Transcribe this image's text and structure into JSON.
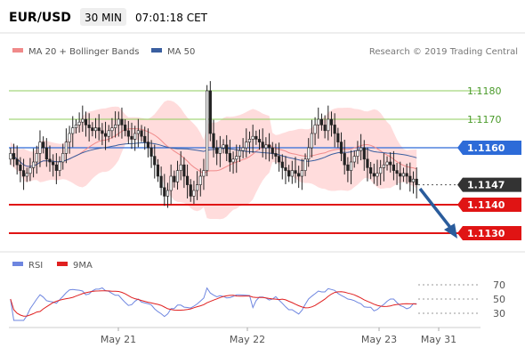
{
  "header": {
    "pair": "EUR/USD",
    "timeframe": "30 MIN",
    "time": "07:01:18 CET"
  },
  "legend": {
    "ma20": "MA 20 + Bollinger Bands",
    "ma50": "MA 50",
    "credit": "Research © 2019 Trading Central"
  },
  "colors": {
    "resistance": "#8fce5c",
    "current_level": "#2d6bd8",
    "support": "#e01414",
    "last_price_box": "#333333",
    "ma20_band": "#ffd6d6",
    "ma20": "#f08a8a",
    "ma50": "#3a5fa0",
    "candle": "#222222",
    "rsi": "#6e86e0",
    "rsi_ma": "#e02020",
    "arrow": "#2a5c9c"
  },
  "chart_data": [
    {
      "type": "candlestick",
      "title": "",
      "x_labels": [
        "May 21",
        "May 22",
        "May 23",
        "May 31"
      ],
      "ylim": [
        1.1125,
        1.119
      ],
      "levels": [
        {
          "value": 1.118,
          "label": "1.1180",
          "kind": "resistance"
        },
        {
          "value": 1.117,
          "label": "1.1170",
          "kind": "resistance"
        },
        {
          "value": 1.116,
          "label": "1.1160",
          "kind": "current"
        },
        {
          "value": 1.1147,
          "label": "1.1147",
          "kind": "last"
        },
        {
          "value": 1.114,
          "label": "1.1140",
          "kind": "support"
        },
        {
          "value": 1.113,
          "label": "1.1130",
          "kind": "support"
        }
      ],
      "last_price": 1.1147,
      "candles_close": [
        1.1158,
        1.1156,
        1.1154,
        1.1152,
        1.115,
        1.1151,
        1.1153,
        1.1155,
        1.1158,
        1.1162,
        1.116,
        1.1156,
        1.1155,
        1.1154,
        1.1152,
        1.1155,
        1.1158,
        1.1162,
        1.1165,
        1.1167,
        1.1168,
        1.1169,
        1.117,
        1.1168,
        1.1167,
        1.1166,
        1.1167,
        1.1166,
        1.1165,
        1.1164,
        1.1166,
        1.1167,
        1.1168,
        1.117,
        1.1168,
        1.1166,
        1.1164,
        1.1163,
        1.1165,
        1.1166,
        1.1164,
        1.1162,
        1.116,
        1.1157,
        1.1154,
        1.115,
        1.1146,
        1.1143,
        1.1145,
        1.115,
        1.1148,
        1.1152,
        1.1154,
        1.115,
        1.1147,
        1.1143,
        1.1145,
        1.1147,
        1.115,
        1.1152,
        1.118,
        1.1165,
        1.116,
        1.1158,
        1.116,
        1.1161,
        1.1158,
        1.1155,
        1.1156,
        1.1157,
        1.1159,
        1.116,
        1.1162,
        1.1163,
        1.1164,
        1.1163,
        1.1162,
        1.116,
        1.1161,
        1.116,
        1.1158,
        1.1157,
        1.1155,
        1.1153,
        1.1152,
        1.115,
        1.1152,
        1.1151,
        1.115,
        1.1152,
        1.1156,
        1.116,
        1.1165,
        1.1168,
        1.117,
        1.1168,
        1.1166,
        1.117,
        1.1168,
        1.1165,
        1.1162,
        1.1158,
        1.1154,
        1.1152,
        1.1155,
        1.1157,
        1.1159,
        1.116,
        1.1156,
        1.1153,
        1.1151,
        1.115,
        1.1151,
        1.1153,
        1.1154,
        1.1155,
        1.1154,
        1.1152,
        1.1151,
        1.115,
        1.1151,
        1.115,
        1.1148,
        1.1149,
        1.1147
      ]
    },
    {
      "type": "line",
      "title": "",
      "series_names": [
        "RSI",
        "9MA"
      ],
      "y_ticks": [
        30,
        50,
        70
      ],
      "ylim": [
        20,
        80
      ]
    }
  ]
}
